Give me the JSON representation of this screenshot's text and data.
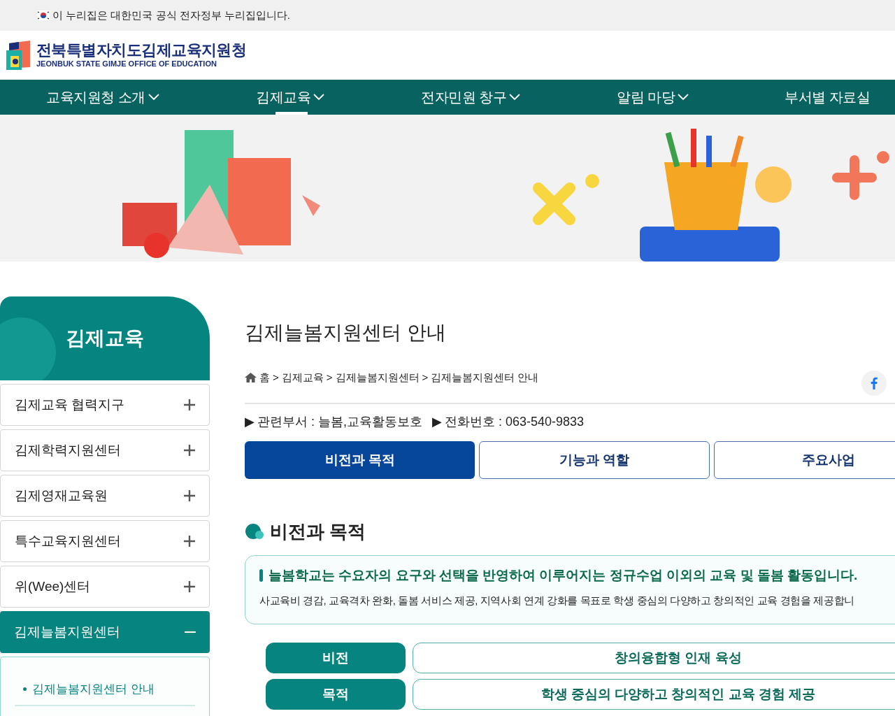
{
  "gov_banner": {
    "text": "이 누리집은 대한민국 공식 전자정부 누리집입니다."
  },
  "logo": {
    "title": "전북특별자치도김제교육지원청",
    "subtitle": "JEONBUK STATE GIMJE OFFICE OF EDUCATION"
  },
  "nav": [
    {
      "label": "교육지원청 소개",
      "selected": false
    },
    {
      "label": "김제교육",
      "selected": true
    },
    {
      "label": "전자민원 창구",
      "selected": false
    },
    {
      "label": "알림 마당",
      "selected": false
    },
    {
      "label": "부서별 자료실",
      "selected": false
    }
  ],
  "banner": {
    "kind": "picture"
  },
  "sidebar": {
    "title": "김제교육",
    "items": [
      {
        "label": "김제교육 협력지구",
        "expanded": false
      },
      {
        "label": "김제학력지원센터",
        "expanded": false
      },
      {
        "label": "김제영재교육원",
        "expanded": false
      },
      {
        "label": "특수교육지원센터",
        "expanded": false
      },
      {
        "label": "위(Wee)센터",
        "expanded": false
      },
      {
        "label": "김제늘봄지원센터",
        "expanded": true,
        "children": [
          {
            "label": "김제늘봄지원센터 안내",
            "selected": true
          }
        ]
      }
    ]
  },
  "page_title": "김제늘봄지원센터 안내",
  "breadcrumb": [
    "홈",
    "김제교육",
    "김제늘봄지원센터",
    "김제늘봄지원센터 안내"
  ],
  "breadcrumb_separator": ">",
  "info": [
    {
      "marker": "▶",
      "text": "관련부서 : 늘봄,교육활동보호"
    },
    {
      "marker": "▶",
      "text": "전화번호 : 063-540-9833"
    }
  ],
  "tabs": [
    {
      "label": "비전과 목적",
      "selected": true
    },
    {
      "label": "기능과 역할",
      "selected": false
    },
    {
      "label": "주요사업",
      "selected": false
    }
  ],
  "section_title": "비전과 목적",
  "callout": {
    "headline": "늘봄학교는 수요자의 요구와 선택을 반영하여 이루어지는 정규수업 이외의 교육 및 돌봄 활동입니다.",
    "body": "사교육비 경감, 교육격차 완화, 돌봄 서비스 제공, 지역사회 연계 강화를 목표로 학생 중심의 다양하고 창의적인 교육 경험을 제공합니"
  },
  "vision_rows": [
    {
      "label": "비전",
      "value": "창의융합형 인재 육성"
    },
    {
      "label": "목적",
      "value": "학생 중심의 다양하고 창의적인 교육 경험 제공"
    }
  ]
}
